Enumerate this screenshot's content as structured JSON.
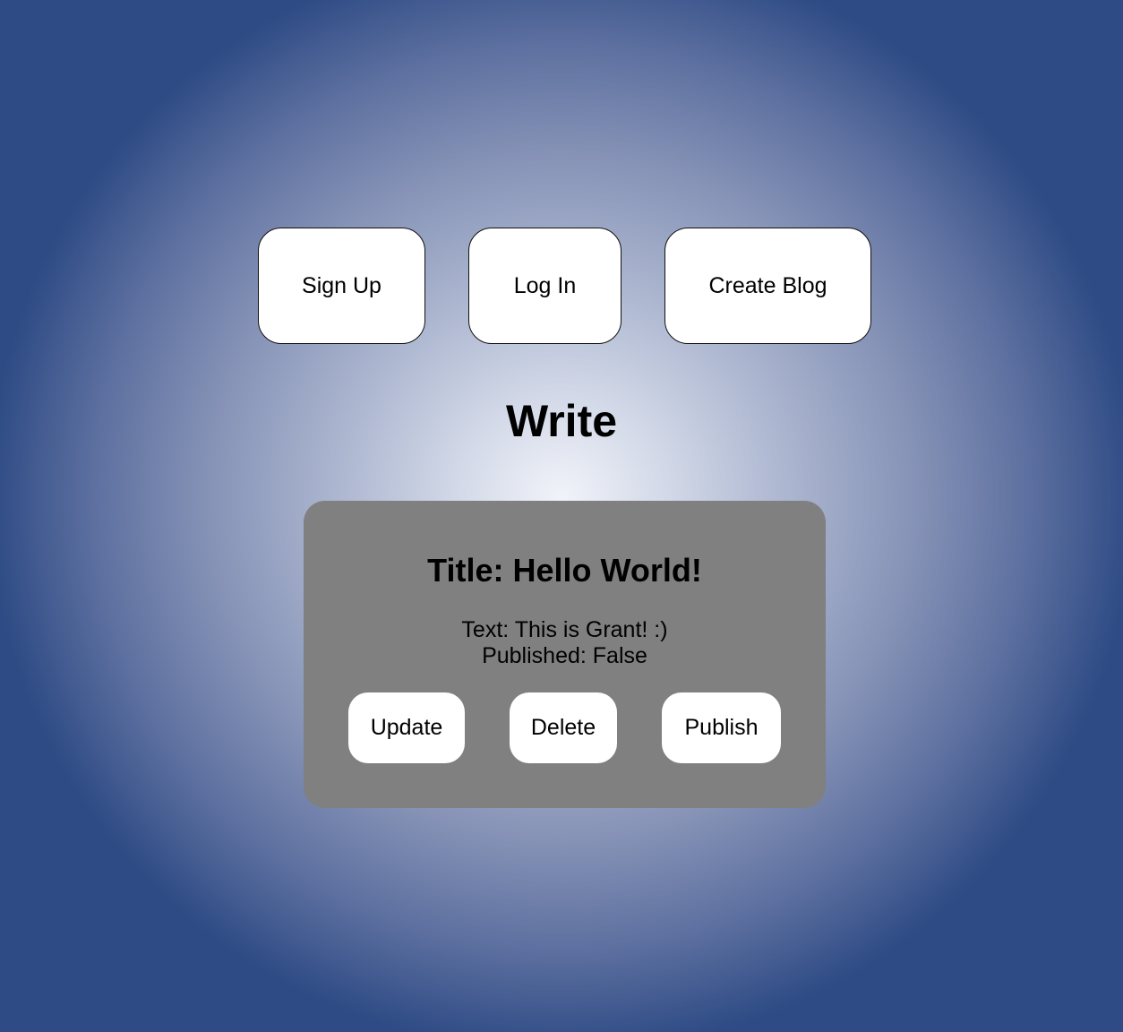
{
  "nav": {
    "signup_label": "Sign Up",
    "login_label": "Log In",
    "create_blog_label": "Create Blog"
  },
  "page": {
    "heading": "Write"
  },
  "post": {
    "title": "Title: Hello World!",
    "text": "Text: This is Grant! :)",
    "published": "Published: False",
    "actions": {
      "update_label": "Update",
      "delete_label": "Delete",
      "publish_label": "Publish"
    }
  },
  "colors": {
    "background_center": "#f1f3f9",
    "background_edge": "#2e4b85",
    "card_background": "#808080",
    "button_background": "#ffffff"
  }
}
